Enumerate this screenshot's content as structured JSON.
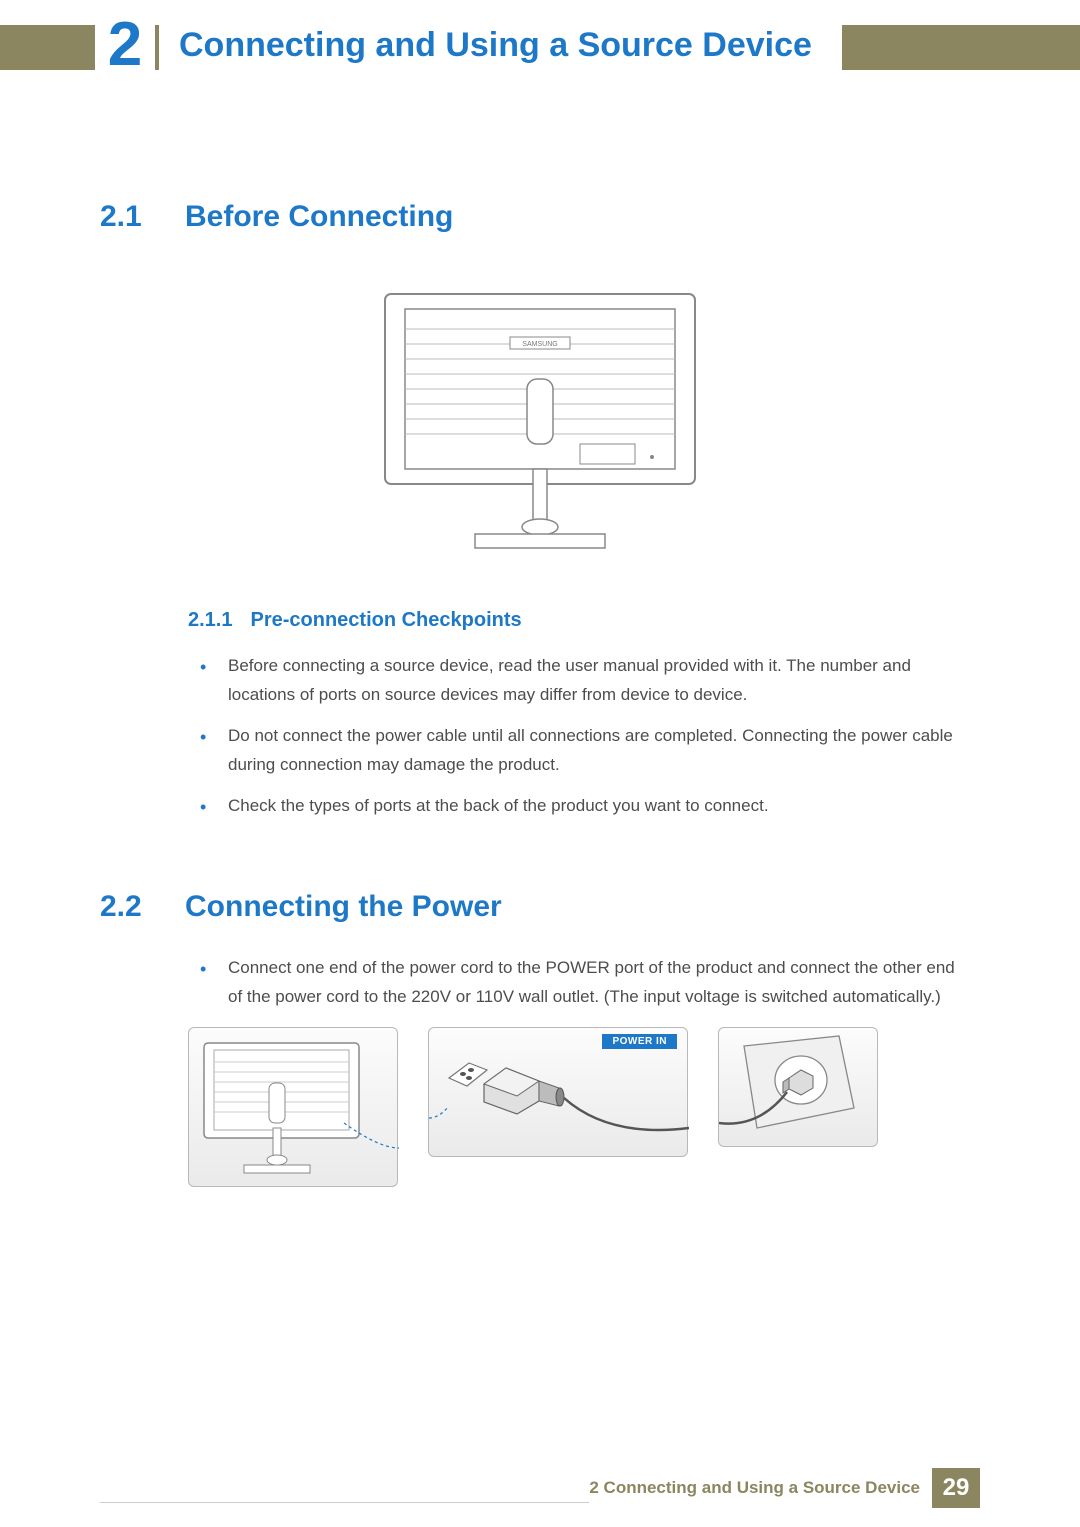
{
  "chapter": {
    "number": "2",
    "title": "Connecting and Using a Source Device"
  },
  "sections": {
    "s2_1": {
      "num": "2.1",
      "title": "Before Connecting"
    },
    "s2_1_1": {
      "num": "2.1.1",
      "title": "Pre-connection Checkpoints"
    },
    "s2_2": {
      "num": "2.2",
      "title": "Connecting the Power"
    }
  },
  "bullets_2_1_1": [
    "Before connecting a source device, read the user manual provided with it. The number and locations of ports on source devices may differ from device to device.",
    "Do not connect the power cable until all connections are completed. Connecting the power cable during connection may damage the product.",
    "Check the types of ports at the back of the product you want to connect."
  ],
  "bullets_2_2": [
    "Connect one end of the power cord to the POWER port of the product and connect the other end of the power cord to the 220V or 110V wall outlet. (The input voltage is switched automatically.)"
  ],
  "figure_labels": {
    "monitor_brand": "SAMSUNG",
    "power_in": "POWER IN"
  },
  "footer": {
    "label": "2 Connecting and Using a Source Device",
    "page": "29"
  }
}
